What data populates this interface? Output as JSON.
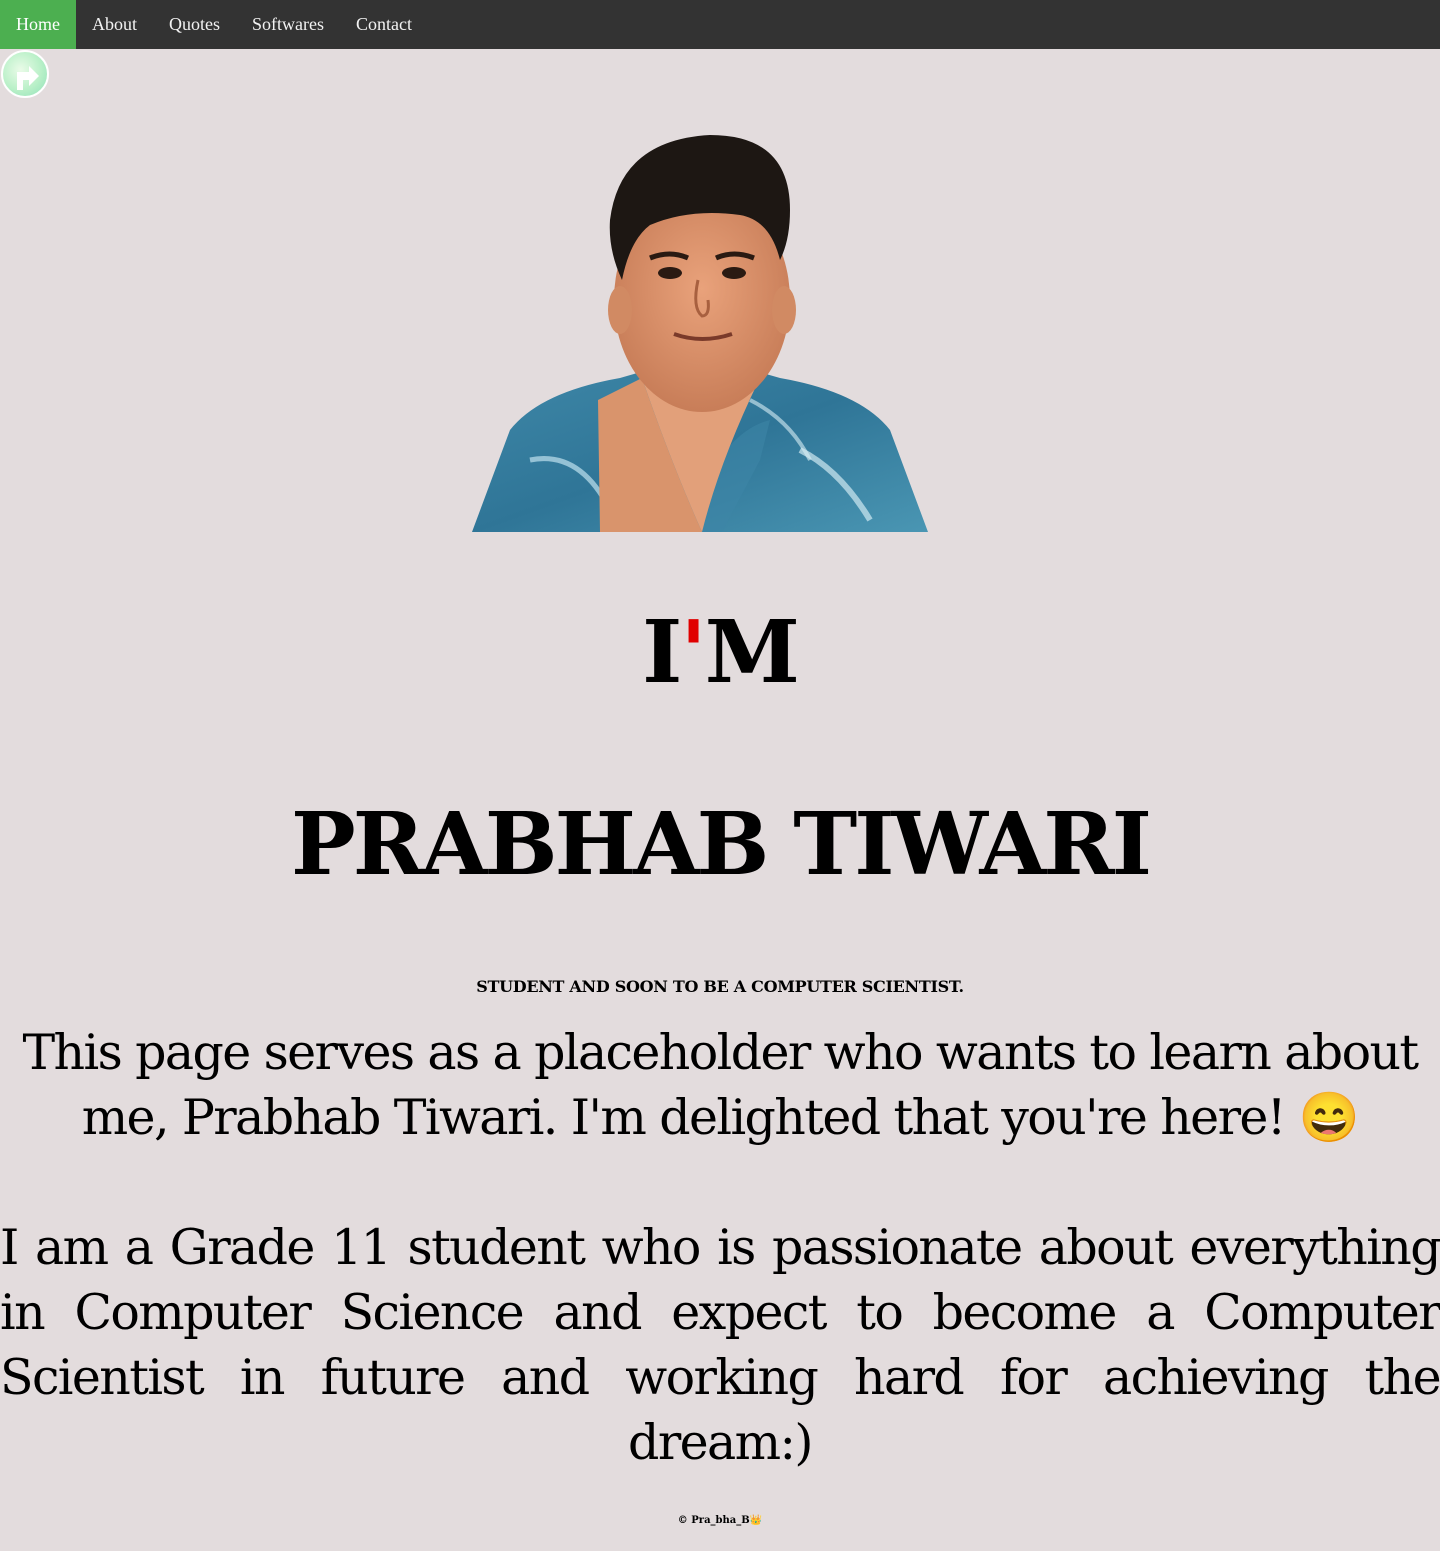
{
  "nav": {
    "items": [
      {
        "label": "Home",
        "active": true
      },
      {
        "label": "About",
        "active": false
      },
      {
        "label": "Quotes",
        "active": false
      },
      {
        "label": "Softwares",
        "active": false
      },
      {
        "label": "Contact",
        "active": false
      }
    ],
    "active_color": "#4caf50",
    "bar_color": "#333333"
  },
  "logo": {
    "icon": "circle-arrow-logo-icon"
  },
  "hero": {
    "photo": "portrait-photo",
    "im_prefix": "I",
    "im_apostrophe": "'",
    "im_suffix": "M",
    "name": "PRABHAB TIWARI",
    "tagline": "STUDENT AND SOON TO BE A COMPUTER SCIENTIST."
  },
  "intro": {
    "text": "This page serves as a placeholder who wants to learn about me, Prabhab Tiwari. I'm delighted that you're here!",
    "emoji": "😄"
  },
  "bio": {
    "text": "I am a Grade 11 student who is passionate about everything in Computer Science and expect to become a Computer Scientist in future and working hard for achieving the dream:)"
  },
  "footer": {
    "text": "© Pra_bha_B👑"
  }
}
